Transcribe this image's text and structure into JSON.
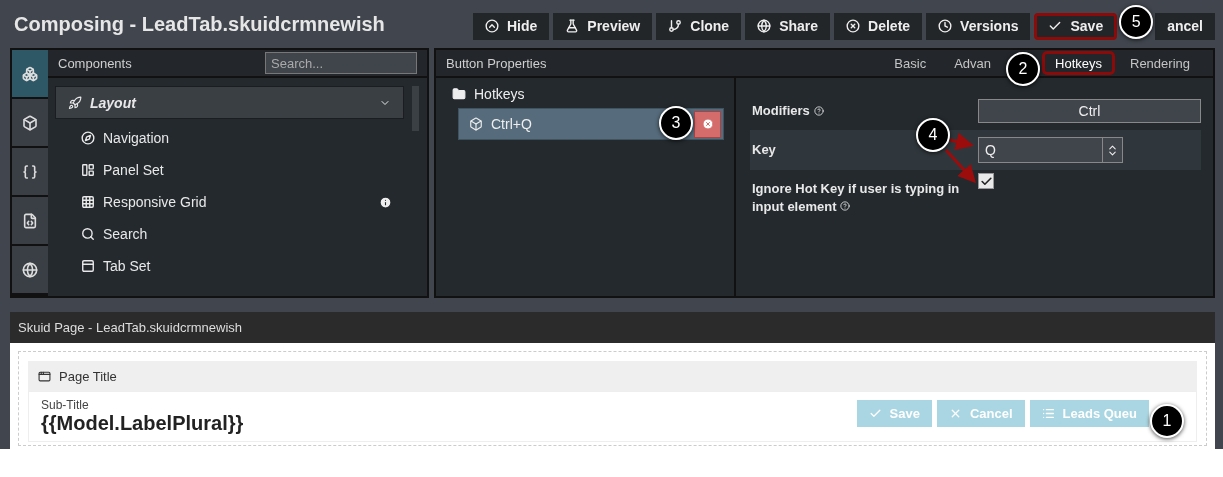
{
  "header": {
    "title": "Composing - LeadTab.skuidcrmnewish",
    "buttons": [
      {
        "label": "Hide",
        "kind": "hide",
        "highlighted": false
      },
      {
        "label": "Preview",
        "kind": "flask",
        "highlighted": false
      },
      {
        "label": "Clone",
        "kind": "branch",
        "highlighted": false
      },
      {
        "label": "Share",
        "kind": "globe",
        "highlighted": false
      },
      {
        "label": "Delete",
        "kind": "delete",
        "highlighted": false
      },
      {
        "label": "Versions",
        "kind": "clock",
        "highlighted": false
      },
      {
        "label": "Save",
        "kind": "check",
        "highlighted": true,
        "callout": "5"
      },
      {
        "label": "ancel",
        "kind": "none",
        "highlighted": false
      }
    ]
  },
  "sidebar": {
    "icons": [
      {
        "kind": "blocks",
        "selected": true
      },
      {
        "kind": "box",
        "selected": false
      },
      {
        "kind": "braces",
        "selected": false
      },
      {
        "kind": "css",
        "selected": false
      },
      {
        "kind": "globe",
        "selected": false
      }
    ]
  },
  "components": {
    "title": "Components",
    "search": {
      "placeholder": "Search..."
    },
    "group": {
      "label": "Layout",
      "expanded": true
    },
    "items": [
      {
        "label": "Navigation",
        "kind": "compass",
        "info": false
      },
      {
        "label": "Panel Set",
        "kind": "panels",
        "info": false
      },
      {
        "label": "Responsive Grid",
        "kind": "grid",
        "info": true
      },
      {
        "label": "Search",
        "kind": "search",
        "info": false
      },
      {
        "label": "Tab Set",
        "kind": "tabs",
        "info": false
      }
    ]
  },
  "properties": {
    "title": "Button Properties",
    "tabs": [
      {
        "label": "Basic",
        "selected": false,
        "highlighted": false
      },
      {
        "label": "Advan",
        "selected": false,
        "highlighted": false
      },
      {
        "label": "Hotkeys",
        "selected": true,
        "highlighted": true,
        "callout": "2"
      },
      {
        "label": "Rendering",
        "selected": false,
        "highlighted": false
      }
    ],
    "tree": {
      "folder": "Hotkeys",
      "items": [
        {
          "label": "Ctrl+Q",
          "selected": true,
          "callout": "3"
        }
      ]
    },
    "form": {
      "modifiers": {
        "label": "Modifiers",
        "value": "Ctrl"
      },
      "key": {
        "label": "Key",
        "value": "Q",
        "callout": "4"
      },
      "ignore": {
        "label": "Ignore Hot Key if user is typing in input element",
        "checked": true
      }
    }
  },
  "canvas": {
    "title": "Skuid Page - LeadTab.skuidcrmnewish",
    "component": "Page Title",
    "subtitle": "Sub-Title",
    "heading": "{{Model.LabelPlural}}",
    "buttons": [
      {
        "label": "Save",
        "kind": "check"
      },
      {
        "label": "Cancel",
        "kind": "x"
      },
      {
        "label": "Leads Queu",
        "kind": "list",
        "callout": "1"
      }
    ]
  }
}
